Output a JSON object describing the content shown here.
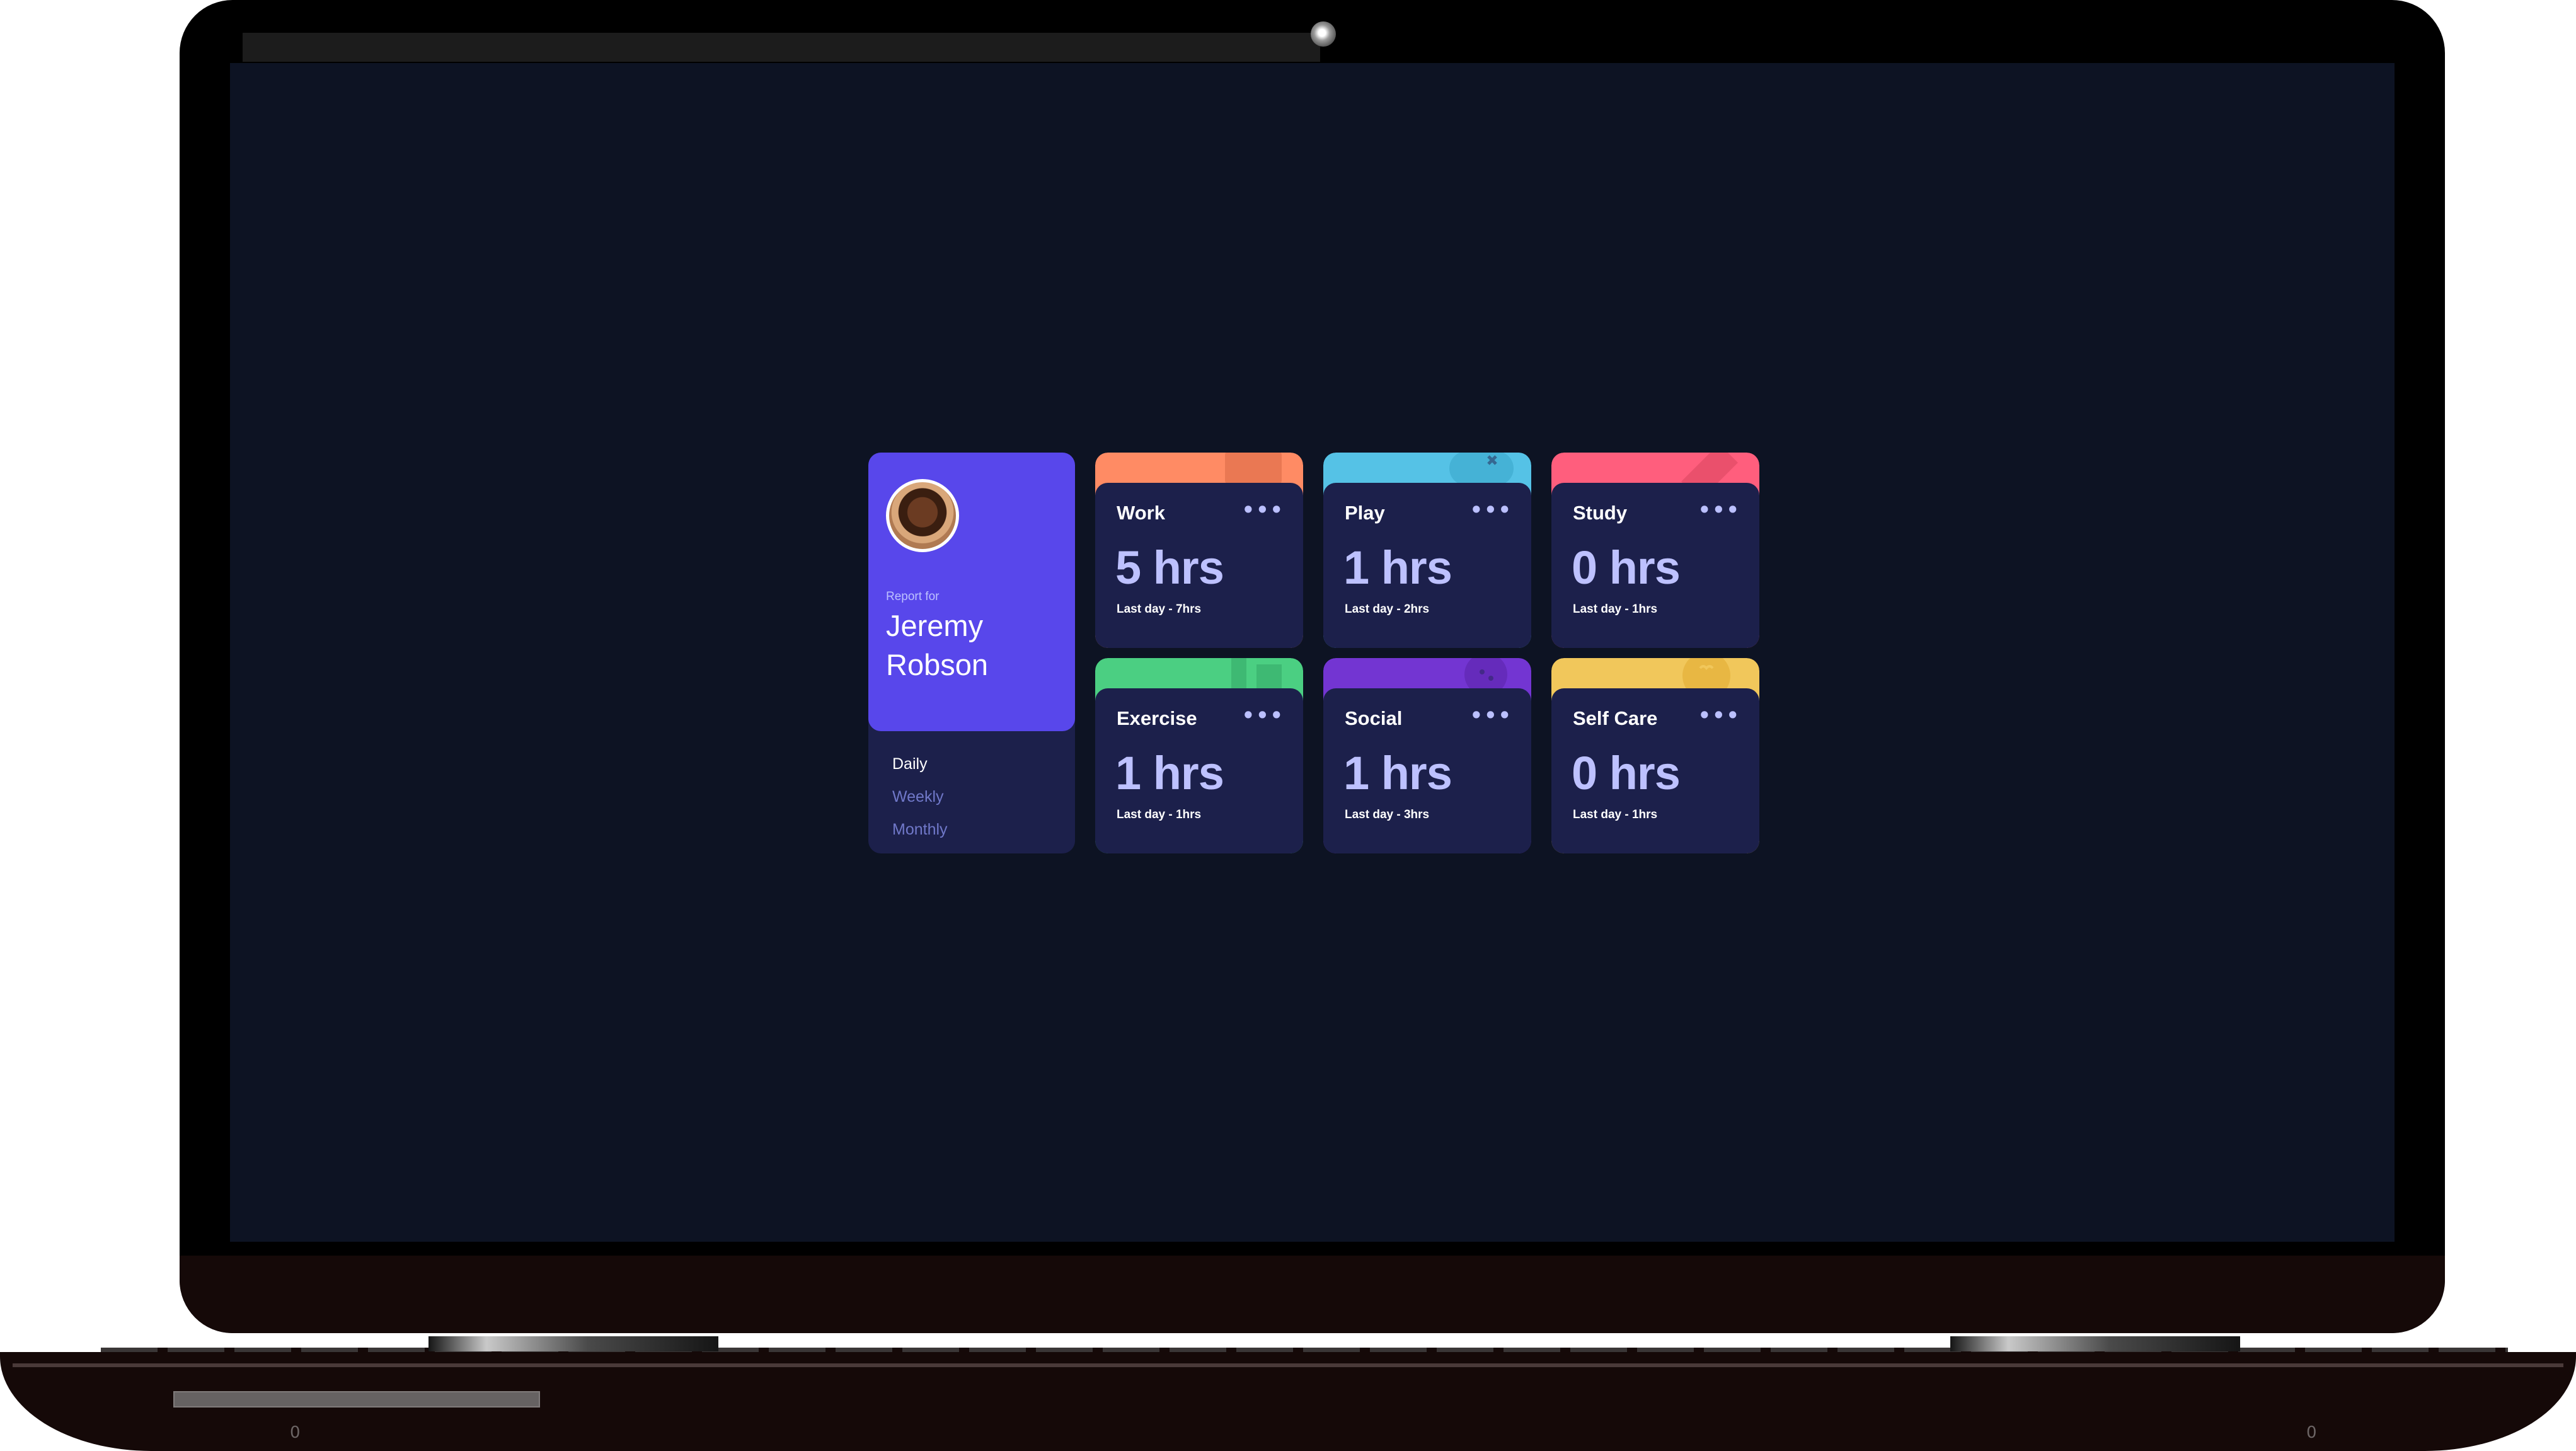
{
  "profile": {
    "label": "Report for",
    "name": "Jeremy Robson"
  },
  "periods": [
    {
      "label": "Daily",
      "active": true
    },
    {
      "label": "Weekly",
      "active": false
    },
    {
      "label": "Monthly",
      "active": false
    }
  ],
  "tiles": [
    {
      "title": "Work",
      "hours": "5 hrs",
      "previous": "Last day - 7hrs",
      "color": "#ff8b64",
      "icon": "briefcase-icon"
    },
    {
      "title": "Play",
      "hours": "1 hrs",
      "previous": "Last day - 2hrs",
      "color": "#55c2e6",
      "icon": "gamepad-icon"
    },
    {
      "title": "Study",
      "hours": "0 hrs",
      "previous": "Last day - 1hrs",
      "color": "#ff5e7d",
      "icon": "book-icon"
    },
    {
      "title": "Exercise",
      "hours": "1 hrs",
      "previous": "Last day - 1hrs",
      "color": "#4bcf82",
      "icon": "runner-icon"
    },
    {
      "title": "Social",
      "hours": "1 hrs",
      "previous": "Last day - 3hrs",
      "color": "#7335d2",
      "icon": "chat-icon"
    },
    {
      "title": "Self Care",
      "hours": "0 hrs",
      "previous": "Last day - 1hrs",
      "color": "#f1c75b",
      "icon": "heart-icon"
    }
  ],
  "tile_menu": "•••",
  "base_marks": [
    "0",
    "0"
  ]
}
